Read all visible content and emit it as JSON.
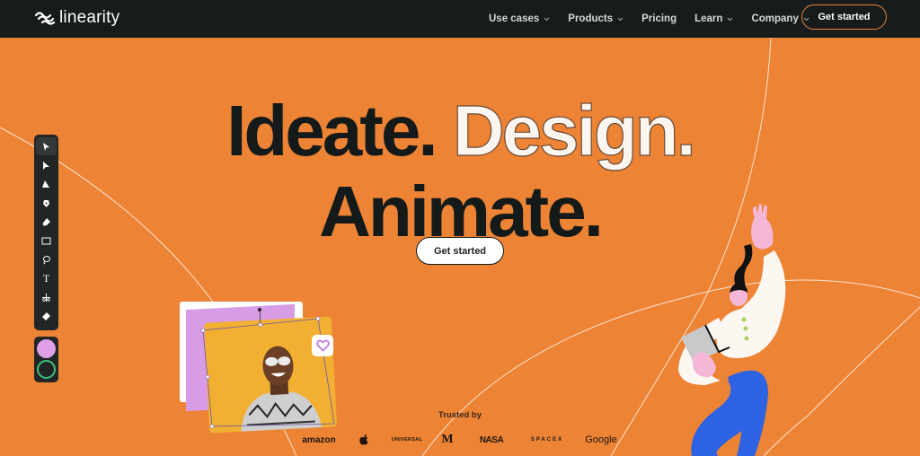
{
  "nav": {
    "logo_text": "linearity",
    "links": [
      {
        "label": "Use cases",
        "has_dropdown": true
      },
      {
        "label": "Products",
        "has_dropdown": true
      },
      {
        "label": "Pricing",
        "has_dropdown": false
      },
      {
        "label": "Learn",
        "has_dropdown": true
      },
      {
        "label": "Company",
        "has_dropdown": true
      }
    ],
    "cta_label": "Get started"
  },
  "hero": {
    "headline_word1": "Ideate.",
    "headline_word2": "Design.",
    "headline_word3": "Animate.",
    "cta_label": "Get started"
  },
  "toolbar": {
    "tools": [
      {
        "icon": "selection-arrow-icon",
        "active": true
      },
      {
        "icon": "direct-selection-icon",
        "active": false
      },
      {
        "icon": "node-selection-icon",
        "active": false
      },
      {
        "icon": "pen-icon",
        "active": false
      },
      {
        "icon": "brush-icon",
        "active": false
      },
      {
        "icon": "rectangle-icon",
        "active": false
      },
      {
        "icon": "lasso-icon",
        "active": false
      },
      {
        "icon": "text-icon",
        "active": false
      },
      {
        "icon": "scissors-icon",
        "active": false
      },
      {
        "icon": "eraser-icon",
        "active": false
      }
    ],
    "fill_color": "#dfa0e8",
    "stroke_color": "#3ec178",
    "text_tool_glyph": "T"
  },
  "trusted": {
    "label": "Trusted by",
    "brands": [
      "amazon",
      "apple",
      "UNIVERSAL",
      "McDonald's",
      "NASA",
      "SPACEX",
      "Google"
    ]
  },
  "colors": {
    "background": "#ed8335",
    "nav_background": "#171b1b",
    "ink": "#141a19",
    "accent_outline": "#ed8335"
  }
}
